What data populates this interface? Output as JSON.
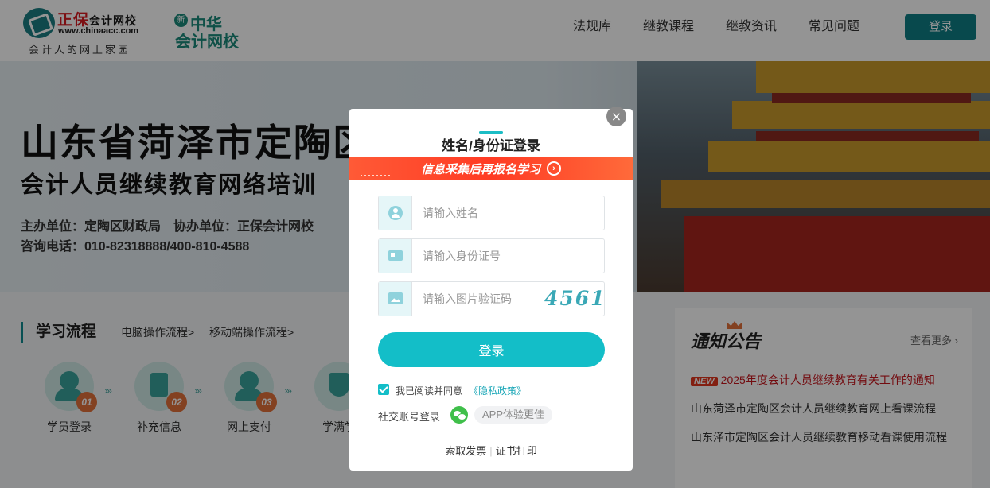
{
  "header": {
    "logo1_name": "正保",
    "logo1_name_suffix": "会计网校",
    "logo1_url": "www.chinaacc.com",
    "logo1_slogan": "会计人的网上家园",
    "logo2_mark": "新",
    "logo2_line1": "中华",
    "logo2_line2": "会计网校",
    "nav": [
      "法规库",
      "继教课程",
      "继教资讯",
      "常见问题"
    ],
    "login_label": "登录"
  },
  "banner": {
    "title": "山东省菏泽市定陶区",
    "subtitle": "会计人员继续教育网络培训",
    "info1": "主办单位：定陶区财政局　协办单位：正保会计网校",
    "info2": "咨询电话：010-82318888/400-810-4588"
  },
  "flow": {
    "title": "学习流程",
    "links": [
      "电脑操作流程>",
      "移动端操作流程>"
    ],
    "steps": [
      {
        "num": "01",
        "label": "学员登录"
      },
      {
        "num": "02",
        "label": "补充信息"
      },
      {
        "num": "03",
        "label": "网上支付"
      },
      {
        "num": "",
        "label": "学满学"
      }
    ]
  },
  "notice": {
    "title": "通知公告",
    "more": "查看更多",
    "new_badge": "NEW",
    "items": [
      "2025年度会计人员继续教育有关工作的通知",
      "山东菏泽市定陶区会计人员继续教育网上看课流程",
      "山东泽市定陶区会计人员继续教育移动看课使用流程"
    ]
  },
  "modal": {
    "close_glyph": "×",
    "title": "姓名/身份证登录",
    "promo": "信息采集后再报名学习",
    "promo_arrow": "›",
    "fields": {
      "name_placeholder": "请输入姓名",
      "id_placeholder": "请输入身份证号",
      "captcha_placeholder": "请输入图片验证码"
    },
    "captcha_text": "4561",
    "login_label": "登录",
    "agree_text": "我已阅读并同意",
    "policy_text": "《隐私政策》",
    "social_text": "社交账号登录",
    "app_tag": "APP体验更佳",
    "bottom_links": [
      "索取发票",
      "证书打印"
    ]
  },
  "colors": {
    "brand_teal": "#0e7f86",
    "button_cyan": "#13bec8",
    "promo_red": "#ff3b24",
    "notice_red": "#c6151d"
  },
  "icons": [
    "user-icon",
    "id-card-icon",
    "image-icon",
    "wechat-icon",
    "close-icon",
    "chevron-right-icon",
    "checkbox-checked-icon"
  ]
}
